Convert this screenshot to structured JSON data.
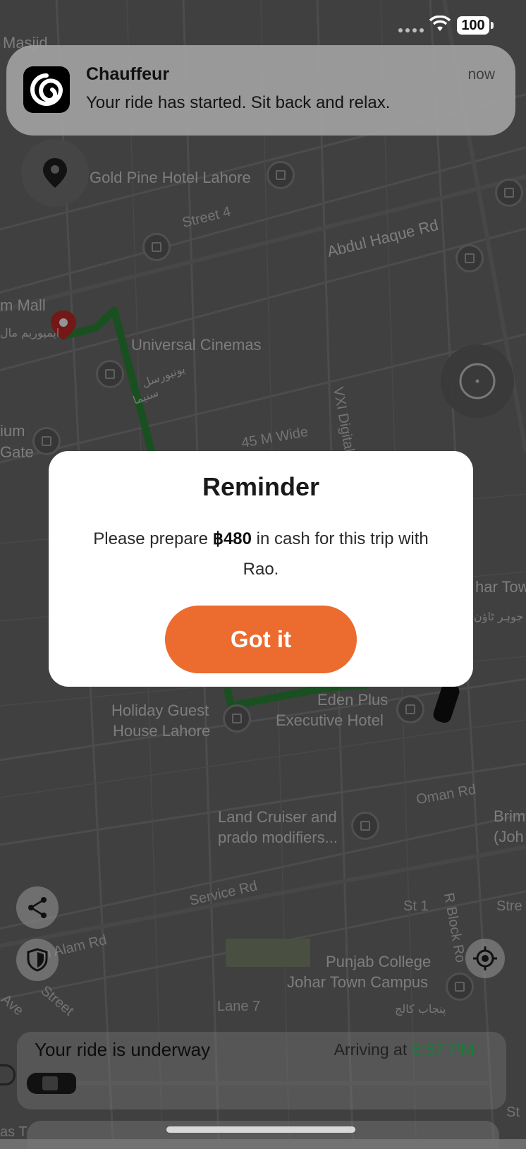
{
  "status_bar": {
    "battery": "100"
  },
  "notification": {
    "app_name": "Chauffeur",
    "time": "now",
    "message": "Your ride has started. Sit back and relax."
  },
  "map": {
    "labels": {
      "masjid": "Masjid",
      "gold_pine": "Gold Pine Hotel Lahore",
      "street4": "Street 4",
      "abdul_haque": "Abdul Haque Rd",
      "mall": "m Mall",
      "universal": "Universal Cinemas",
      "ium": "ium",
      "gate": "Gate",
      "m_wide": "45 M Wide",
      "vxi": "VXI Digital",
      "har_tow": "har Tow",
      "holiday1": "Holiday Guest",
      "holiday2": "House Lahore",
      "eden1": "Eden Plus",
      "eden2": "Executive Hotel",
      "oman": "Oman Rd",
      "land1": "Land Cruiser and",
      "land2": "prado modifiers...",
      "brim": "Brim",
      "joh": "(Joh",
      "service": "Service Rd",
      "st1": "St 1",
      "rblock": "R Block Ro",
      "stre": "Stre",
      "alam": "n Alam Rd",
      "punjab1": "Punjab College",
      "punjab2": "Johar Town Campus",
      "lane7": "Lane 7",
      "ave": "Ave",
      "street_b": "Street",
      "st_right": "St",
      "as_t": "as T"
    },
    "urdu": {
      "mall_ur": "ایمپوریم مال",
      "universal_ur1": "یونیورسل",
      "universal_ur2": "سنیما",
      "johar_ur": "جوہر ٹاؤن",
      "punjab_ur": "پنجاب کالج"
    }
  },
  "modal": {
    "title": "Reminder",
    "body_prefix": "Please prepare",
    "amount": "฿480",
    "body_suffix": "in cash for this trip with Rao.",
    "button": "Got it"
  },
  "ride": {
    "status": "Your ride is underway",
    "arriving_label": "Arriving at",
    "arriving_time": "5:57 PM",
    "progress": 0.02
  },
  "colors": {
    "accent": "#ec6b2e",
    "route": "#2e8b3a",
    "time": "#1f7a3c"
  }
}
